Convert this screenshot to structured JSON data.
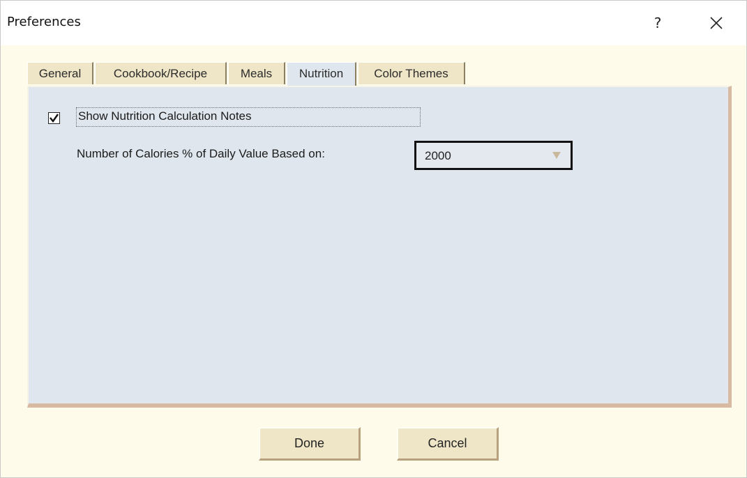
{
  "window": {
    "title": "Preferences",
    "help_label": "?",
    "close_icon": "close-icon"
  },
  "tabs": [
    {
      "label": "General",
      "active": false
    },
    {
      "label": "Cookbook/Recipe",
      "active": false
    },
    {
      "label": "Meals",
      "active": false
    },
    {
      "label": "Nutrition",
      "active": true
    },
    {
      "label": "Color Themes",
      "active": false
    }
  ],
  "nutrition": {
    "show_notes_label": "Show Nutrition Calculation Notes",
    "show_notes_checked": true,
    "calories_label": "Number of Calories % of Daily Value Based on:",
    "calories_value": "2000"
  },
  "buttons": {
    "done": "Done",
    "cancel": "Cancel"
  },
  "colors": {
    "dialog_background": "#fffbea",
    "panel_background": "#dfe6ee",
    "tab_background": "#efe6c8",
    "button_background": "#efe6c8"
  }
}
